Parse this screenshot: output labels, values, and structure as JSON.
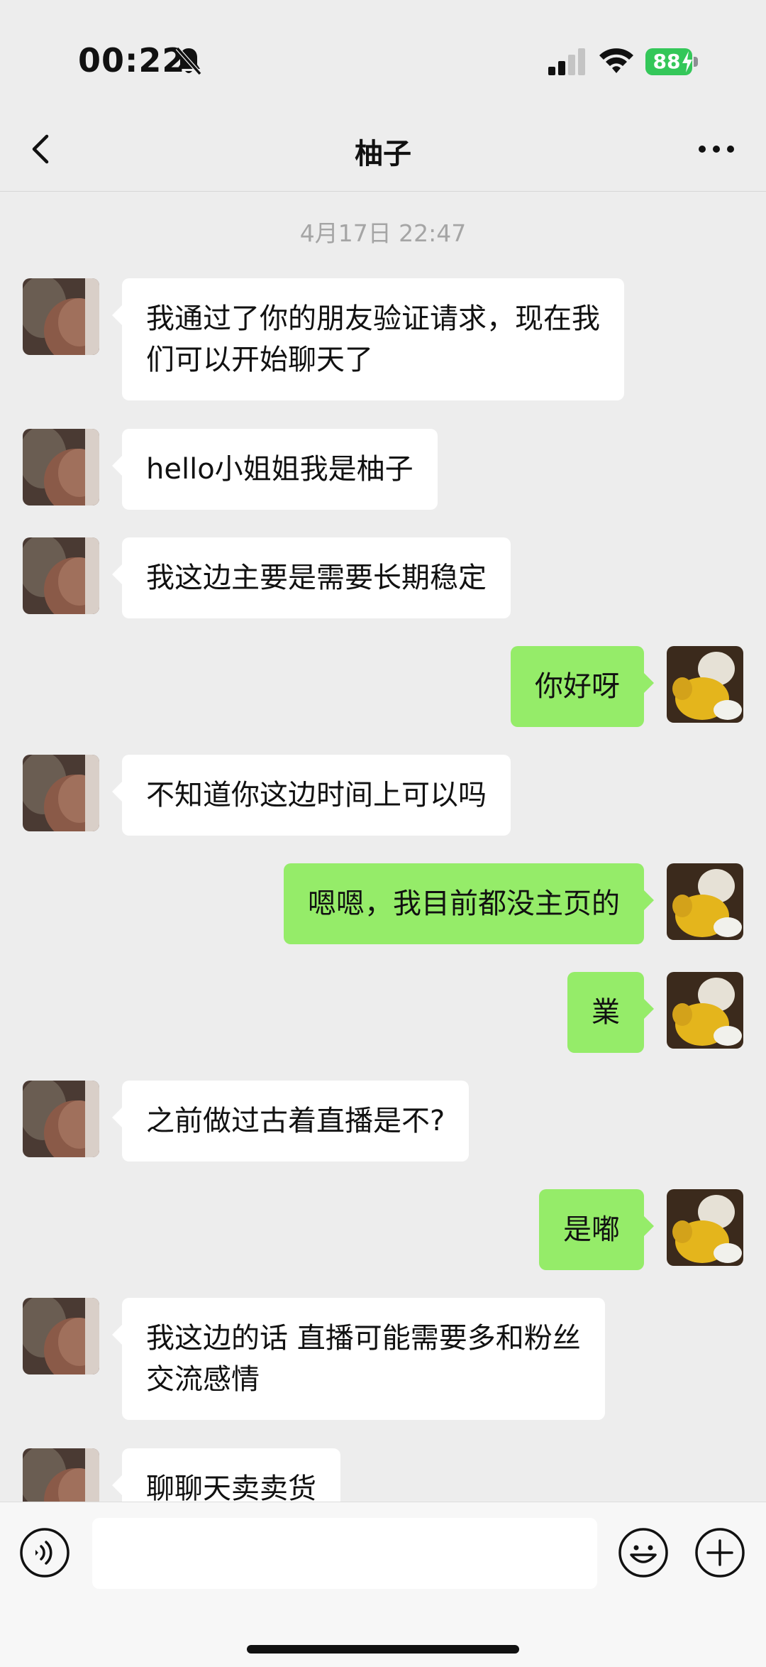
{
  "status_bar": {
    "time": "00:22",
    "battery_level": "88",
    "icons": [
      "bell-slash-icon",
      "cellular-signal-icon",
      "wifi-icon",
      "battery-charging-icon"
    ]
  },
  "nav": {
    "title": "柚子",
    "back_icon": "chevron-left-icon",
    "more_icon": "ellipsis-icon"
  },
  "chat": {
    "timestamp": "4月17日 22:47",
    "messages": [
      {
        "side": "in",
        "lines": [
          "我通过了你的朋友验证请求，现在我",
          "们可以开始聊天了"
        ]
      },
      {
        "side": "in",
        "lines": [
          "hello小姐姐我是柚子"
        ]
      },
      {
        "side": "in",
        "lines": [
          "我这边主要是需要长期稳定"
        ]
      },
      {
        "side": "out",
        "lines": [
          "你好呀"
        ]
      },
      {
        "side": "in",
        "lines": [
          "不知道你这边时间上可以吗"
        ]
      },
      {
        "side": "out",
        "lines": [
          "嗯嗯，我目前都没主页的"
        ]
      },
      {
        "side": "out",
        "lines": [
          "業"
        ]
      },
      {
        "side": "in",
        "lines": [
          "之前做过古着直播是不?"
        ]
      },
      {
        "side": "out",
        "lines": [
          "是嘟"
        ]
      },
      {
        "side": "in",
        "lines": [
          "我这边的话 直播可能需要多和粉丝",
          "交流感情"
        ]
      },
      {
        "side": "in",
        "lines": [
          "聊聊天卖卖货"
        ]
      }
    ]
  },
  "input_bar": {
    "text_value": "",
    "icons": [
      "voice-icon",
      "emoji-icon",
      "plus-icon"
    ]
  },
  "colors": {
    "background": "#ededed",
    "incoming_bubble": "#ffffff",
    "outgoing_bubble": "#95ec69",
    "battery": "#34c759"
  }
}
